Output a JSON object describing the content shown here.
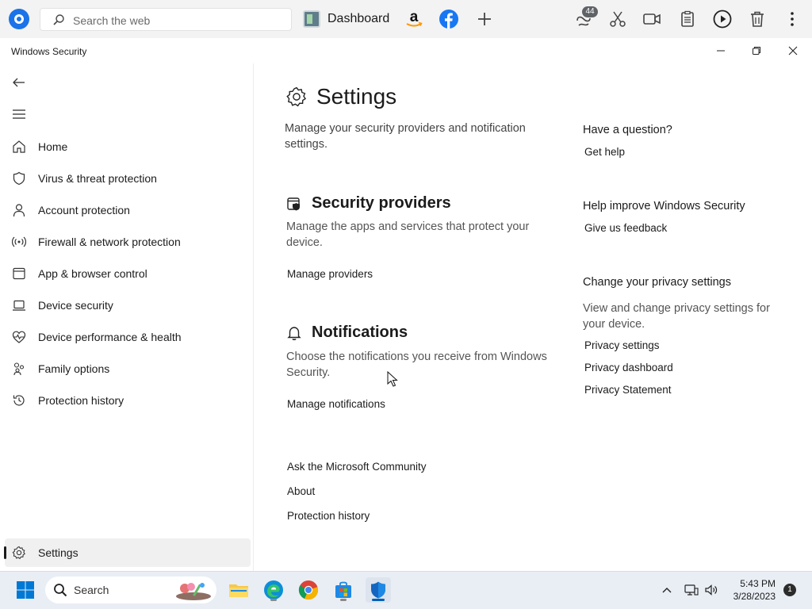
{
  "browser_bar": {
    "search_placeholder": "Search the web",
    "dashboard_label": "Dashboard",
    "badge_count": "44",
    "icons": [
      "app-logo-icon",
      "search-icon",
      "dashboard-icon",
      "amazon-icon",
      "facebook-icon",
      "add-tab-icon",
      "extension-badge-icon",
      "scissors-icon",
      "video-icon",
      "clipboard-icon",
      "play-icon",
      "trash-icon",
      "more-icon"
    ]
  },
  "window": {
    "title": "Windows Security",
    "controls": [
      "minimize-icon",
      "maximize-icon",
      "close-icon"
    ]
  },
  "sidebar": {
    "items": [
      {
        "label": "Home",
        "icon": "home-icon"
      },
      {
        "label": "Virus & threat protection",
        "icon": "shield-icon"
      },
      {
        "label": "Account protection",
        "icon": "person-icon"
      },
      {
        "label": "Firewall & network protection",
        "icon": "wifi-signal-icon"
      },
      {
        "label": "App & browser control",
        "icon": "browser-window-icon"
      },
      {
        "label": "Device security",
        "icon": "laptop-icon"
      },
      {
        "label": "Device performance & health",
        "icon": "heart-pulse-icon"
      },
      {
        "label": "Family options",
        "icon": "family-icon"
      },
      {
        "label": "Protection history",
        "icon": "history-icon"
      }
    ],
    "settings_label": "Settings"
  },
  "main": {
    "title": "Settings",
    "intro": "Manage your security providers and notification settings.",
    "providers": {
      "title": "Security providers",
      "description": "Manage the apps and services that protect your device.",
      "link": "Manage providers"
    },
    "notifications": {
      "title": "Notifications",
      "description": "Choose the notifications you receive from Windows Security.",
      "link": "Manage notifications"
    },
    "footer_links": [
      "Ask the Microsoft Community",
      "About",
      "Protection history"
    ]
  },
  "aside": {
    "question_heading": "Have a question?",
    "get_help": "Get help",
    "improve_heading": "Help improve Windows Security",
    "feedback": "Give us feedback",
    "privacy_heading": "Change your privacy settings",
    "privacy_desc": "View and change privacy settings for your  device.",
    "privacy_links": [
      "Privacy settings",
      "Privacy dashboard",
      "Privacy Statement"
    ]
  },
  "taskbar": {
    "search_label": "Search",
    "time": "5:43 PM",
    "date": "3/28/2023",
    "notification_count": "1",
    "apps": [
      "windows-start-icon",
      "file-explorer-icon",
      "edge-icon",
      "chrome-icon",
      "store-icon",
      "windows-security-icon"
    ],
    "tray": [
      "chevron-up-icon",
      "network-icon",
      "volume-icon"
    ]
  },
  "colors": {
    "accent": "#005fb8",
    "nav_active_bg": "#f0f0f0",
    "taskbar_bg": "#e9eef5",
    "browser_bar_bg": "#f3f3f3"
  }
}
